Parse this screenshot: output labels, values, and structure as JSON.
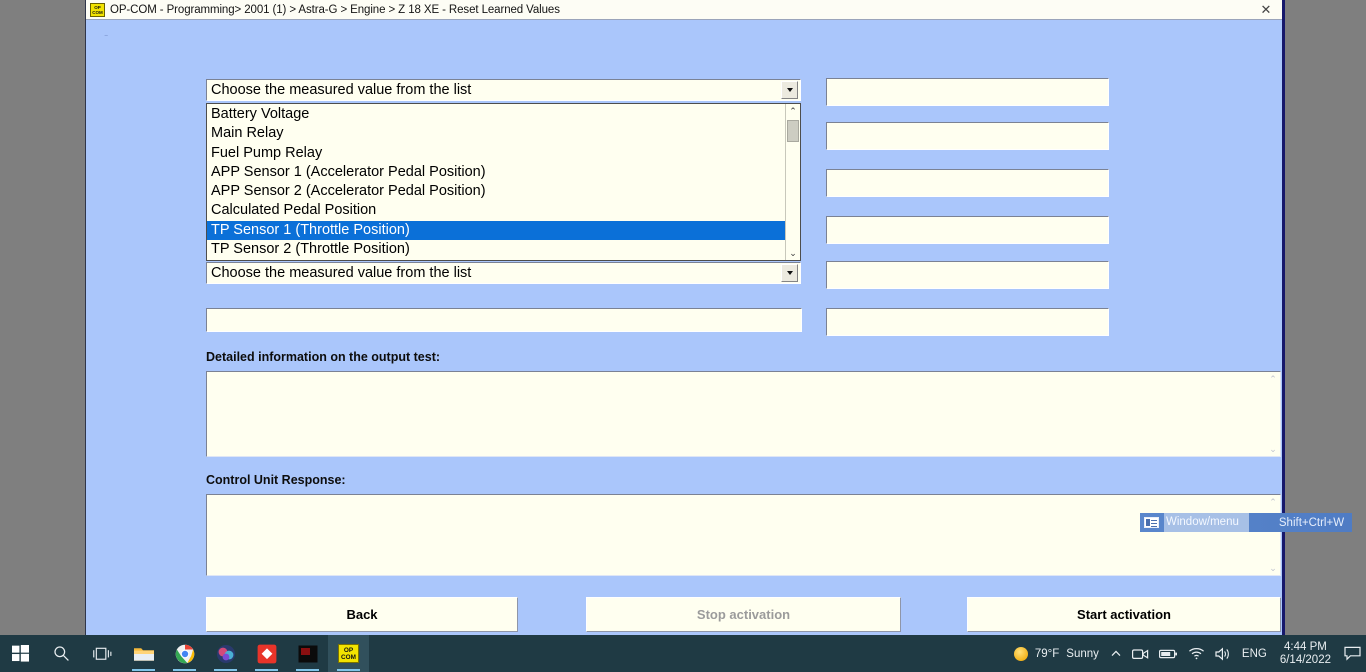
{
  "window": {
    "title": "OP-COM - Programming> 2001 (1) > Astra-G > Engine > Z 18 XE - Reset Learned Values",
    "icon_line1": "OP",
    "icon_line2": "COM",
    "close_label": "✕",
    "corner_mark": "-"
  },
  "form": {
    "combo_top_value": "Choose the measured value from the list",
    "combo_bottom_value": "Choose the measured value from the list",
    "dropdown_items": [
      "Battery Voltage",
      "Main Relay",
      "Fuel Pump Relay",
      "APP Sensor 1 (Accelerator Pedal Position)",
      "APP Sensor 2 (Accelerator Pedal Position)",
      "Calculated Pedal Position",
      "TP Sensor 1 (Throttle Position)",
      "TP Sensor 2 (Throttle Position)"
    ],
    "dropdown_selected_index": 6,
    "left_text_field_value": "",
    "value_fields": [
      "",
      "",
      "",
      "",
      "",
      ""
    ],
    "scroll_up_glyph": "⌃",
    "scroll_down_glyph": "⌄"
  },
  "sections": {
    "output_test_label": "Detailed information on the output test:",
    "output_test_value": "",
    "control_unit_label": "Control Unit Response:",
    "control_unit_value": ""
  },
  "buttons": {
    "back": "Back",
    "stop": "Stop activation",
    "start": "Start activation"
  },
  "floating_menu": {
    "label": "Window/menu",
    "shortcut": "Shift+Ctrl+W"
  },
  "taskbar": {
    "icons": [
      "start-icon",
      "search-icon",
      "task-view-icon",
      "file-explorer-icon",
      "chrome-icon",
      "media-app-icon",
      "red-diamond-app-icon",
      "dark-app-icon",
      "opcom-app-icon"
    ],
    "opcom_icon_line1": "OP",
    "opcom_icon_line2": "COM",
    "weather_temp": "79°F",
    "weather_condition": "Sunny",
    "language": "ENG",
    "time": "4:44 PM",
    "date": "6/14/2022",
    "chevron": "⌃"
  },
  "colors": {
    "window_background": "#aac6fb",
    "field_background": "#fffff0",
    "selection_blue": "#0b70d8",
    "desktop_gray": "#7f7f7f",
    "taskbar": "#1f3a44",
    "window_border": "#17186b"
  }
}
